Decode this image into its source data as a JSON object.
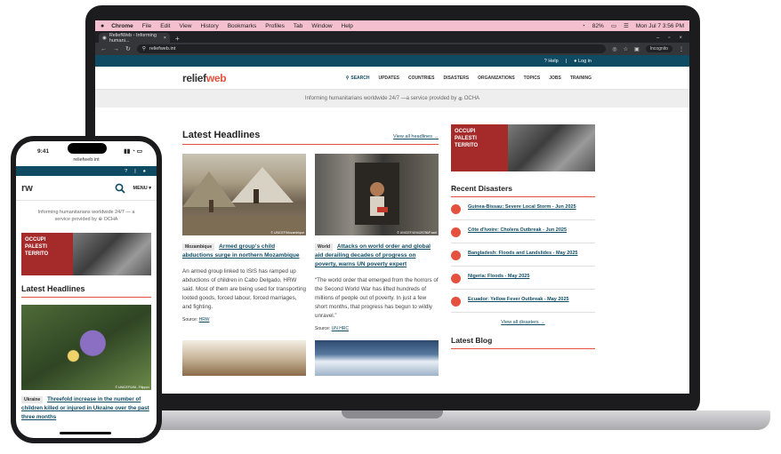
{
  "macbar": {
    "apple": "",
    "menus": [
      "Chrome",
      "File",
      "Edit",
      "View",
      "History",
      "Bookmarks",
      "Profiles",
      "Tab",
      "Window",
      "Help"
    ],
    "battery": "82%",
    "datetime": "Mon Jul 7  3:56 PM"
  },
  "browser": {
    "tab_title": "ReliefWeb - Informing humani...",
    "tab_close": "×",
    "new_tab": "+",
    "url": "reliefweb.int",
    "profile": "Incognito"
  },
  "site": {
    "help": "Help",
    "login": "Log in",
    "logo_main": "relief",
    "logo_accent": "web",
    "nav": {
      "search": "SEARCH",
      "updates": "UPDATES",
      "countries": "COUNTRIES",
      "disasters": "DISASTERS",
      "organizations": "ORGANIZATIONS",
      "topics": "TOPICS",
      "jobs": "JOBS",
      "training": "TRAINING"
    },
    "tagline": "Informing humanitarians worldwide 24/7 —a service provided by",
    "ocha": "OCHA"
  },
  "headlines": {
    "title": "Latest Headlines",
    "view_all": "View all headlines →",
    "cards": [
      {
        "badge": "Mozambique",
        "title": "Armed group's child abductions surge in northern Mozambique",
        "text": "An armed group linked to ISIS has ramped up abductions of children in Cabo Delgado, HRW said. Most of them are being used for transporting looted goods, forced labour, forced marriages, and fighting.",
        "source_label": "Source:",
        "source": "HRW",
        "credit": "© UNICEF/Mozambique"
      },
      {
        "badge": "World",
        "title": "Attacks on world order and global aid derailing decades of progress on poverty, warns UN poverty expert",
        "text": "“The world order that emerged from the horrors of the Second World War has lifted hundreds of millions of people out of poverty. In just a few short months, that progress has begun to wildly unravel.”",
        "source_label": "Source:",
        "source": "UN HRC",
        "credit": "© UNICEF/UNI426786/Fazel"
      }
    ]
  },
  "sidebar": {
    "banner_text": "OCCUPIED PALESTINIAN TERRITO...",
    "banner_line1": "OCCUPI",
    "banner_line2": "PALESTI",
    "banner_line3": "TERRITO",
    "recent_title": "Recent Disasters",
    "disasters": [
      "Guinea-Bissau: Severe Local Storm - Jun 2025",
      "Côte d'Ivoire: Cholera Outbreak - Jun 2025",
      "Bangladesh: Floods and Landslides - May 2025",
      "Nigeria: Floods - May 2025",
      "Ecuador: Yellow Fever Outbreak - May 2025"
    ],
    "view_all_disasters": "View all disasters →",
    "blog_title": "Latest Blog"
  },
  "phone": {
    "time": "9:41",
    "url": "reliefweb.int",
    "help": "?",
    "logo": "rw",
    "menu": "MENU ▾",
    "tagline": "Informing humanitarians worldwide 24/7 — a service provided by",
    "ocha": "OCHA",
    "banner_line1": "OCCUPI",
    "banner_line2": "PALESTI",
    "banner_line3": "TERRITO",
    "headlines_title": "Latest Headlines",
    "badge": "Ukraine",
    "headline": "Threefold increase in the number of children killed or injured in Ukraine over the past three months",
    "credit": "© UNICEF/UNI...Filippov"
  },
  "colors": {
    "brand_teal": "#0f4c63",
    "accent_red": "#e4513f",
    "mac_menubar": "#f4bfcf"
  }
}
